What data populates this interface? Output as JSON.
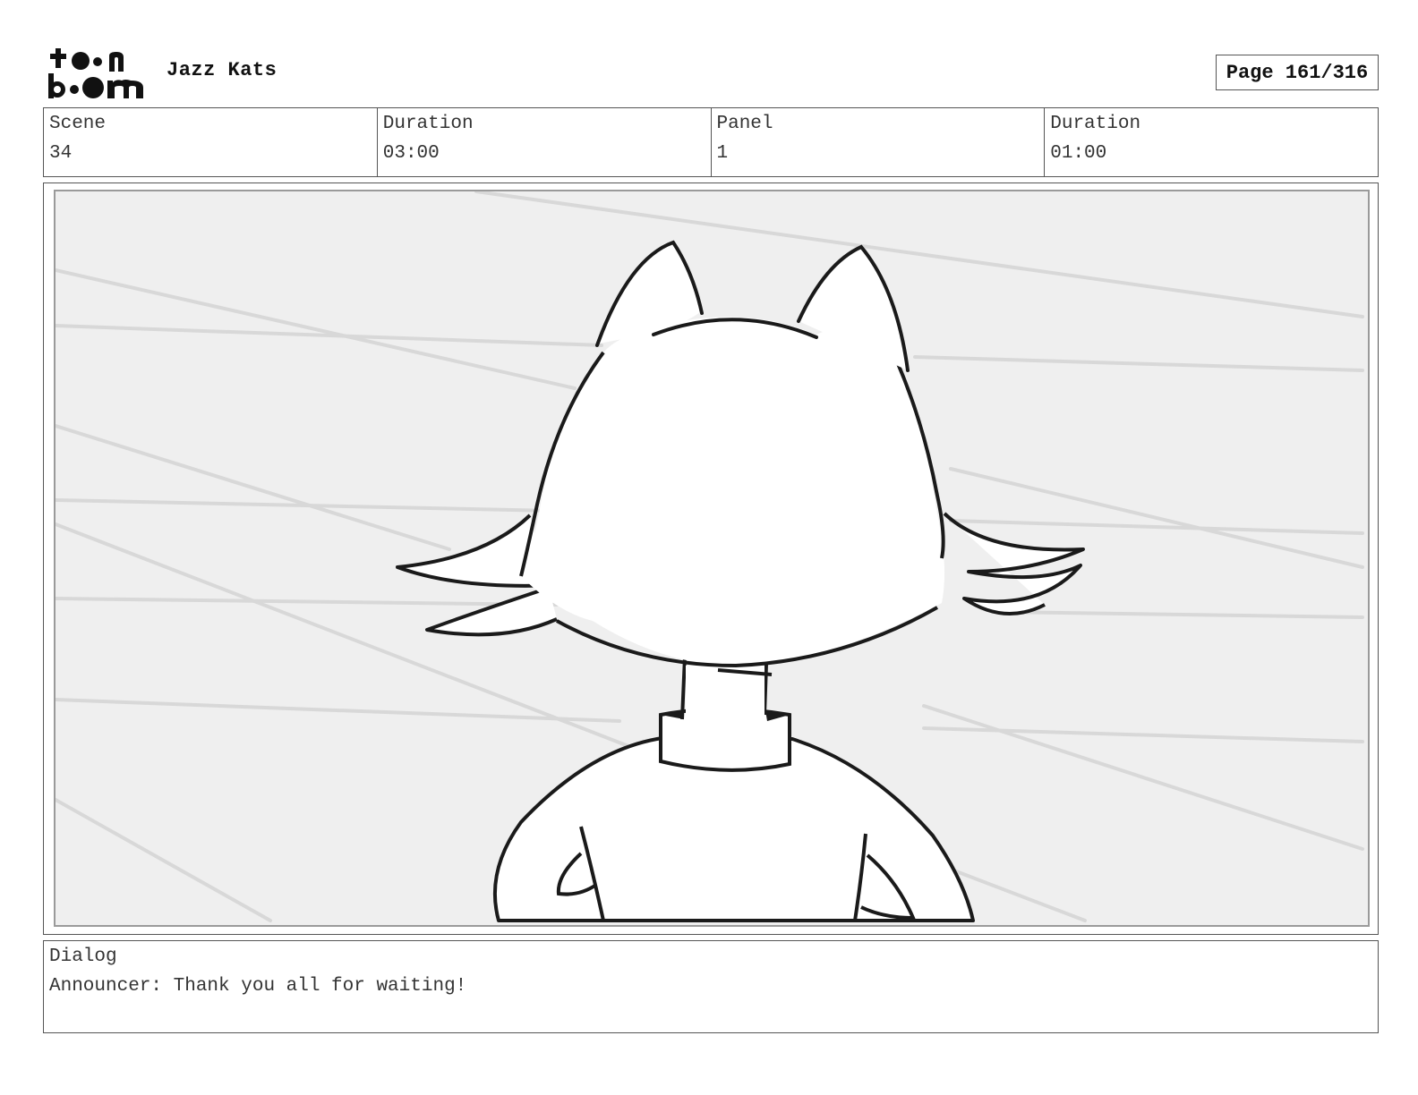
{
  "header": {
    "logo_text_top": "toon",
    "logo_text_bottom": "boom",
    "project_title": "Jazz Kats",
    "page_label": "Page 161/316"
  },
  "info": {
    "scene_label": "Scene",
    "scene_value": "34",
    "scene_duration_label": "Duration",
    "scene_duration_value": "03:00",
    "panel_label": "Panel",
    "panel_value": "1",
    "panel_duration_label": "Duration",
    "panel_duration_value": "01:00"
  },
  "dialog": {
    "label": "Dialog",
    "text": "Announcer: Thank you all for waiting!"
  },
  "colors": {
    "panel_background": "#efefef",
    "ink": "#1a1a1a",
    "border": "#555555"
  }
}
